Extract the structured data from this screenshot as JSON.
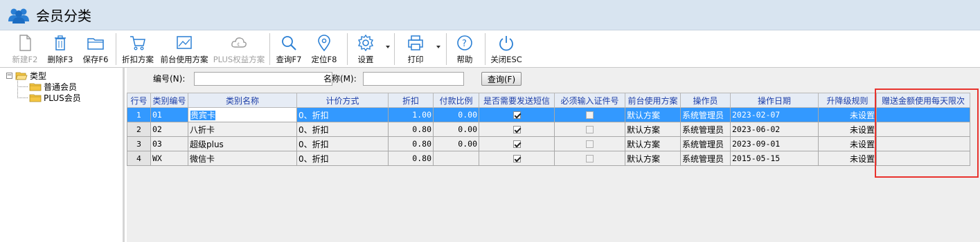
{
  "window": {
    "title": "会员分类",
    "app_icon": "users-icon"
  },
  "toolbar": {
    "new": "新建F2",
    "delete": "删除F3",
    "save": "保存F6",
    "discount_plan": "折扣方案",
    "front_plan": "前台使用方案",
    "plus_plan": "PLUS权益方案",
    "query": "查询F7",
    "locate": "定位F8",
    "settings": "设置",
    "print": "打印",
    "help": "帮助",
    "close": "关闭ESC"
  },
  "tree": {
    "root": "类型",
    "children": [
      "普通会员",
      "PLUS会员"
    ]
  },
  "search": {
    "code_label": "编号(N):",
    "code_value": "",
    "name_label": "名称(M):",
    "name_value": "",
    "query_button": "查询(F)"
  },
  "grid": {
    "headers": [
      "行号",
      "类别编号",
      "类别名称",
      "计价方式",
      "折扣",
      "付款比例",
      "是否需要发送短信",
      "必须输入证件号",
      "前台使用方案",
      "操作员",
      "操作日期",
      "升降级规则",
      "赠送金额使用每天限次"
    ],
    "rows": [
      {
        "no": "1",
        "code": "01",
        "name": "贵宾卡",
        "pricing": "0、折扣",
        "discount": "1.00",
        "pay_ratio": "0.00",
        "sms": true,
        "id_required": false,
        "front_plan": "默认方案",
        "operator": "系统管理员",
        "date": "2023-02-07",
        "rule": "未设置",
        "daily_limit": "",
        "selected": true
      },
      {
        "no": "2",
        "code": "02",
        "name": "八折卡",
        "pricing": "0、折扣",
        "discount": "0.80",
        "pay_ratio": "0.00",
        "sms": true,
        "id_required": false,
        "front_plan": "默认方案",
        "operator": "系统管理员",
        "date": "2023-06-02",
        "rule": "未设置",
        "daily_limit": ""
      },
      {
        "no": "3",
        "code": "03",
        "name": "超级plus",
        "pricing": "0、折扣",
        "discount": "0.80",
        "pay_ratio": "0.00",
        "sms": true,
        "id_required": false,
        "front_plan": "默认方案",
        "operator": "系统管理员",
        "date": "2023-09-01",
        "rule": "未设置",
        "daily_limit": ""
      },
      {
        "no": "4",
        "code": "WX",
        "name": "微信卡",
        "pricing": "0、折扣",
        "discount": "0.80",
        "pay_ratio": "",
        "sms": true,
        "id_required": false,
        "front_plan": "默认方案",
        "operator": "系统管理员",
        "date": "2015-05-15",
        "rule": "未设置",
        "daily_limit": ""
      }
    ]
  },
  "colors": {
    "title_bg": "#d8e4f0",
    "header_text": "#1d3ea8",
    "selection": "#3399ff",
    "highlight_box": "#e8322d",
    "icon_blue": "#2a7fd4"
  }
}
